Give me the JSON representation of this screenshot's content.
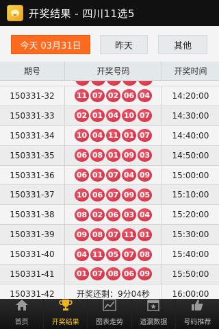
{
  "app": {
    "title": "开奖结果 - 四川11选5"
  },
  "datebar": {
    "today": "今天  03月31日",
    "yesterday": "昨天",
    "other": "其他"
  },
  "table": {
    "headers": [
      "期号",
      "开奖号码",
      "开奖时间"
    ],
    "rows": [
      {
        "issue": "150331-32",
        "balls": [
          "11",
          "07",
          "02",
          "06",
          "04"
        ],
        "time": "14:20:00"
      },
      {
        "issue": "150331-33",
        "balls": [
          "02",
          "01",
          "04",
          "10",
          "07"
        ],
        "time": "14:30:00"
      },
      {
        "issue": "150331-34",
        "balls": [
          "10",
          "04",
          "11",
          "01",
          "07"
        ],
        "time": "14:40:00"
      },
      {
        "issue": "150331-35",
        "balls": [
          "06",
          "08",
          "01",
          "09",
          "03"
        ],
        "time": "14:50:00"
      },
      {
        "issue": "150331-36",
        "balls": [
          "06",
          "01",
          "07",
          "04",
          "09"
        ],
        "time": "15:00:00"
      },
      {
        "issue": "150331-37",
        "balls": [
          "10",
          "06",
          "07",
          "09",
          "05"
        ],
        "time": "15:10:00"
      },
      {
        "issue": "150331-38",
        "balls": [
          "08",
          "02",
          "06",
          "03",
          "04"
        ],
        "time": "15:20:00"
      },
      {
        "issue": "150331-39",
        "balls": [
          "09",
          "08",
          "07",
          "11",
          "01"
        ],
        "time": "15:30:00"
      },
      {
        "issue": "150331-40",
        "balls": [
          "04",
          "11",
          "05",
          "07",
          "08"
        ],
        "time": "15:40:00"
      },
      {
        "issue": "150331-41",
        "balls": [
          "01",
          "07",
          "08",
          "06",
          "09"
        ],
        "time": "15:50:00"
      }
    ],
    "pending": {
      "issue": "150331-42",
      "countdown": "开奖还剩：9分04秒",
      "time": "16:00:00"
    }
  },
  "nav": [
    {
      "label": "首页",
      "icon": "home-icon"
    },
    {
      "label": "开奖结果",
      "icon": "trophy-icon",
      "active": true
    },
    {
      "label": "图表走势",
      "icon": "chart-icon"
    },
    {
      "label": "遗漏数据",
      "icon": "calendar-icon"
    },
    {
      "label": "号码推荐",
      "icon": "thumbs-up-icon"
    }
  ],
  "colors": {
    "accent": "#ff6a1f",
    "ball": "#d9323f",
    "active_nav": "#f7c21f",
    "titlebar": "#111111"
  }
}
